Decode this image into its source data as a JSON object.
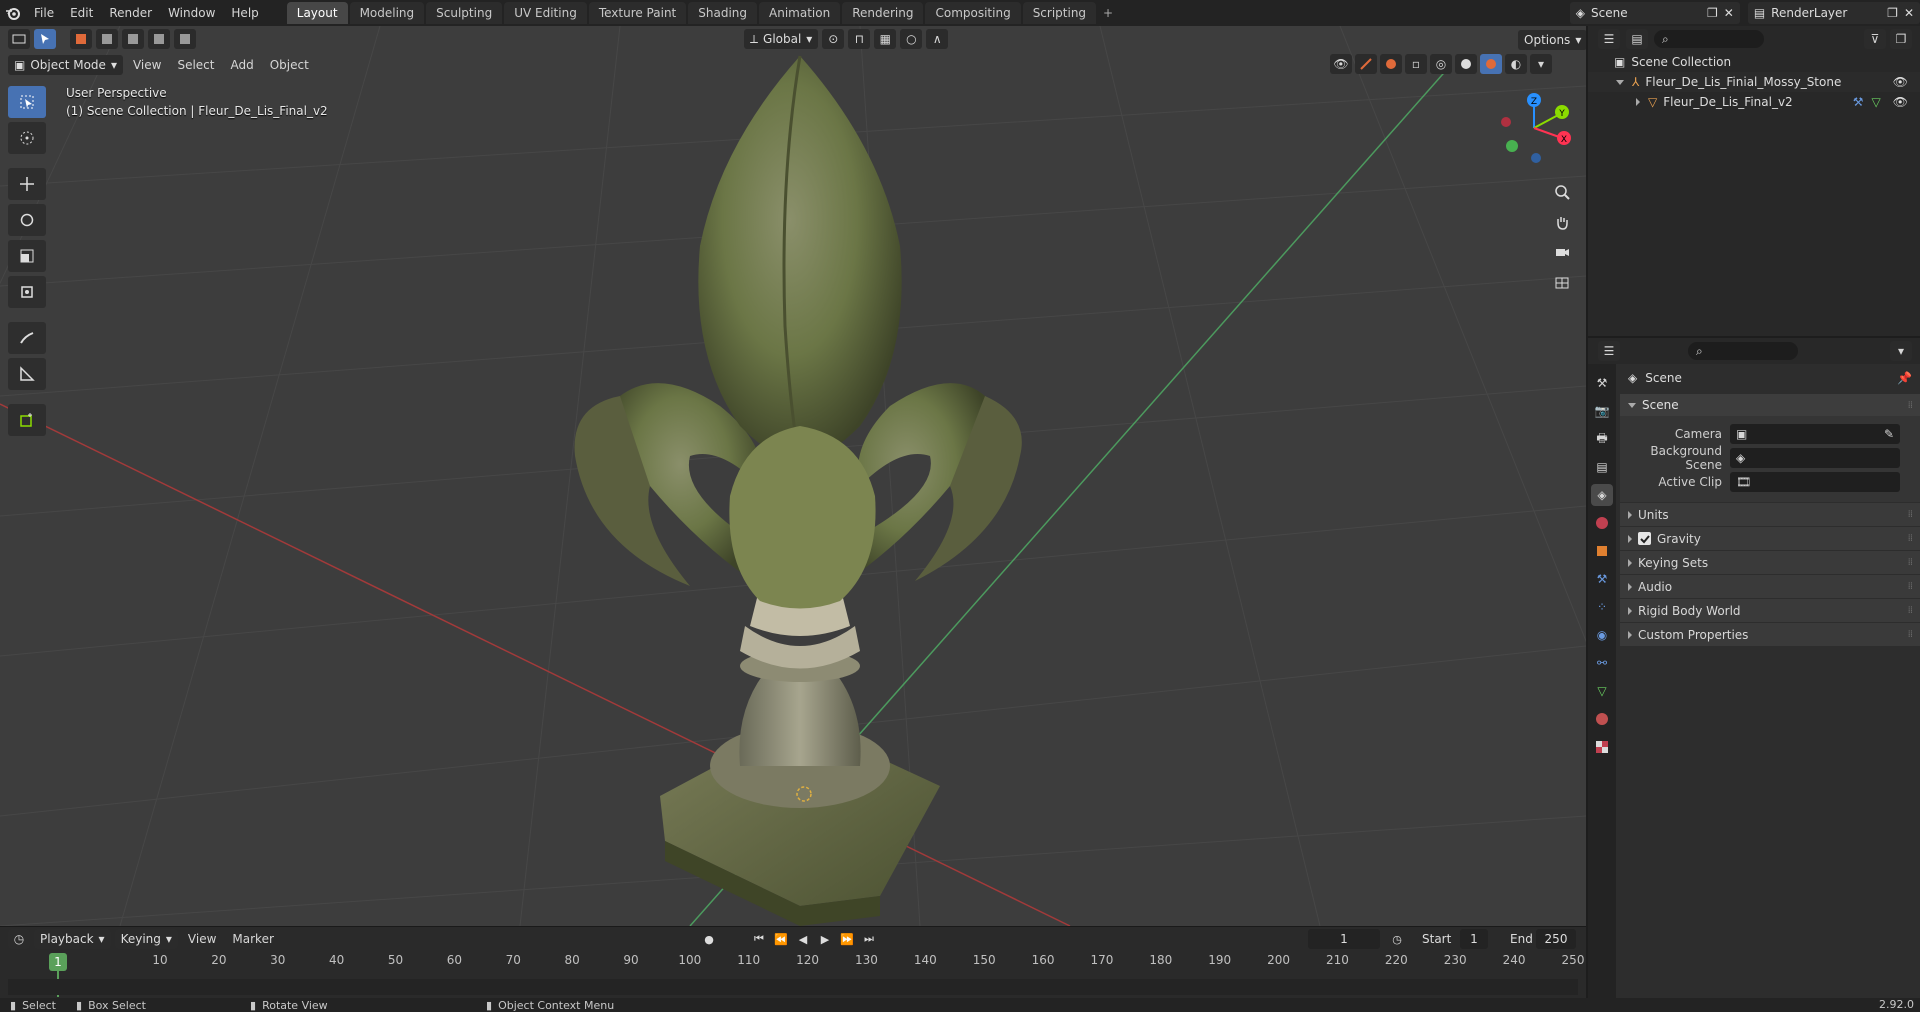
{
  "topbar": {
    "menus": [
      "File",
      "Edit",
      "Render",
      "Window",
      "Help"
    ],
    "workspaces": [
      "Layout",
      "Modeling",
      "Sculpting",
      "UV Editing",
      "Texture Paint",
      "Shading",
      "Animation",
      "Rendering",
      "Compositing",
      "Scripting"
    ],
    "active_workspace": "Layout",
    "scene_name": "Scene",
    "view_layer": "RenderLayer"
  },
  "viewport": {
    "mode": "Object Mode",
    "menus": [
      "View",
      "Select",
      "Add",
      "Object"
    ],
    "transform_orientation": "Global",
    "options_label": "Options",
    "info_line1": "User Perspective",
    "info_line2": "(1) Scene Collection | Fleur_De_Lis_Final_v2",
    "gizmo": {
      "x": "X",
      "y": "Y",
      "z": "Z"
    }
  },
  "outliner": {
    "root": "Scene Collection",
    "items": [
      {
        "name": "Fleur_De_Lis_Finial_Mossy_Stone"
      },
      {
        "name": "Fleur_De_Lis_Final_v2"
      }
    ]
  },
  "properties": {
    "context": "Scene",
    "panel_title": "Scene",
    "fields": [
      {
        "label": "Camera",
        "value": ""
      },
      {
        "label": "Background Scene",
        "value": ""
      },
      {
        "label": "Active Clip",
        "value": ""
      }
    ],
    "subpanels": [
      "Units",
      "Gravity",
      "Keying Sets",
      "Audio",
      "Rigid Body World",
      "Custom Properties"
    ],
    "gravity_checked": true
  },
  "timeline": {
    "menus": [
      "Playback",
      "Keying",
      "View",
      "Marker"
    ],
    "current_frame": "1",
    "start_label": "Start",
    "start": "1",
    "end_label": "End",
    "end": "250",
    "ticks": [
      "10",
      "20",
      "30",
      "40",
      "50",
      "60",
      "70",
      "80",
      "90",
      "100",
      "110",
      "120",
      "130",
      "140",
      "150",
      "160",
      "170",
      "180",
      "190",
      "200",
      "210",
      "220",
      "230",
      "240",
      "250"
    ],
    "playhead": "1"
  },
  "statusbar": {
    "select": "Select",
    "box_select": "Box Select",
    "rotate": "Rotate View",
    "context_menu": "Object Context Menu",
    "version": "2.92.0"
  },
  "colors": {
    "accent": "#4772b3",
    "x_axis": "#ff3352",
    "y_axis": "#8bdc00",
    "z_axis": "#2890ff"
  }
}
